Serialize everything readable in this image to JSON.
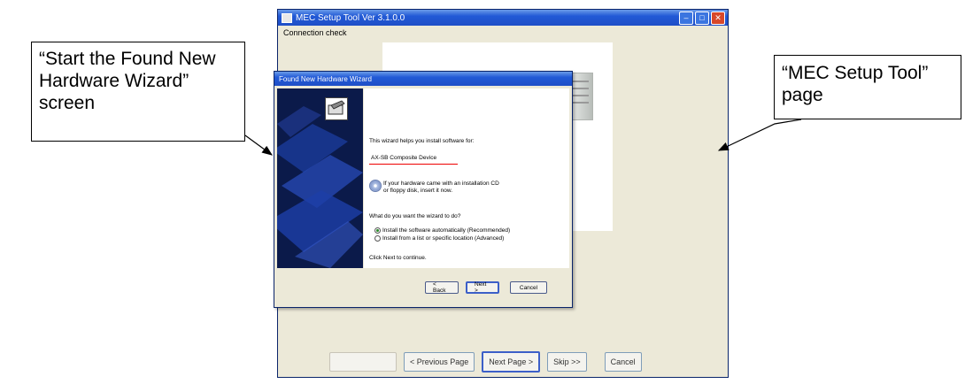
{
  "callouts": {
    "wizard_label": "“Start the Found New\nHardware Wizard”\nscreen",
    "mec_label": "“MEC Setup Tool”\npage"
  },
  "mec_window": {
    "title": "MEC Setup Tool  Ver 3.1.0.0",
    "header": "Connection check",
    "buttons": {
      "first": "",
      "previous": "< Previous Page",
      "next": "Next Page >",
      "skip": "Skip >>",
      "cancel": "Cancel"
    }
  },
  "wizard": {
    "title": "Found New Hardware Wizard",
    "intro": "This wizard helps you install software for:",
    "device": "AX-SB Composite Device",
    "cd_line1": "If your hardware came with an installation CD",
    "cd_line2": "or floppy disk, insert it now.",
    "question": "What do you want the wizard to do?",
    "option_auto": "Install the software automatically (Recommended)",
    "option_manual": "Install from a list or specific location (Advanced)",
    "continue": "Click Next to continue.",
    "buttons": {
      "back": "< Back",
      "next": "Next >",
      "cancel": "Cancel"
    }
  },
  "colors": {
    "titlebar": "#2159d6",
    "window_bg": "#ece9d8",
    "underline": "#e00000"
  }
}
